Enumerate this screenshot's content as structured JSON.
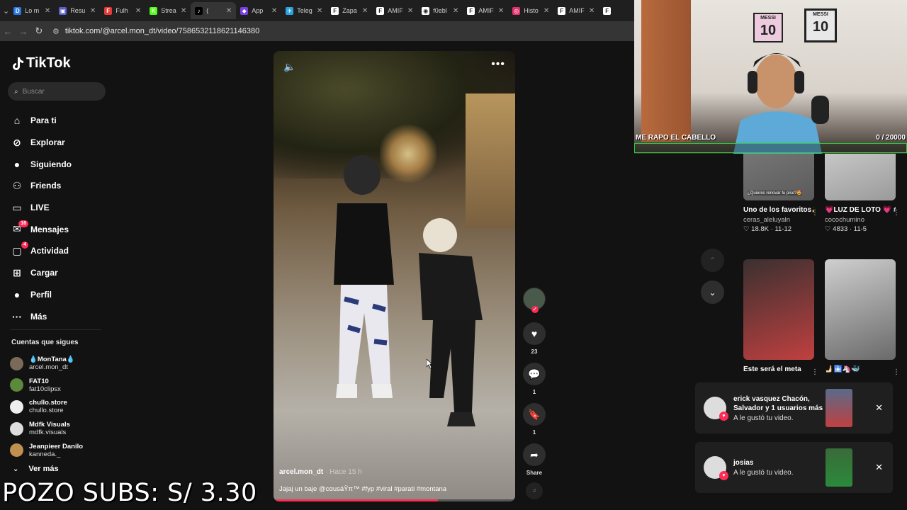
{
  "browser": {
    "tabs": [
      {
        "label": "Lo m",
        "color": "#2b78e4",
        "glyph": "D"
      },
      {
        "label": "Resu",
        "color": "#5b5fc7",
        "glyph": "▣"
      },
      {
        "label": "Fulh",
        "color": "#e53935",
        "glyph": "F"
      },
      {
        "label": "Strea",
        "color": "#53fc18",
        "glyph": "K"
      },
      {
        "label": "(",
        "color": "#000000",
        "glyph": "♪",
        "active": true
      },
      {
        "label": "App",
        "color": "#7b3fe4",
        "glyph": "◆"
      },
      {
        "label": "Teleg",
        "color": "#2aa3e0",
        "glyph": "✈"
      },
      {
        "label": "Zapa",
        "color": "#ffffff",
        "glyph": "F"
      },
      {
        "label": "AMIF",
        "color": "#ffffff",
        "glyph": "F"
      },
      {
        "label": "f0ebl",
        "color": "#ffffff",
        "glyph": "◉"
      },
      {
        "label": "AMIF",
        "color": "#ffffff",
        "glyph": "F"
      },
      {
        "label": "Histo",
        "color": "#e1306c",
        "glyph": "◎"
      },
      {
        "label": "AMIF",
        "color": "#ffffff",
        "glyph": "F"
      },
      {
        "label": "",
        "color": "#ffffff",
        "glyph": "F"
      }
    ],
    "url": "tiktok.com/@arcel.mon_dt/video/7586532118621146380"
  },
  "sidebar": {
    "logo": "TikTok",
    "search_placeholder": "Buscar",
    "menu": [
      {
        "label": "Para ti",
        "icon": "home-icon"
      },
      {
        "label": "Explorar",
        "icon": "compass-icon"
      },
      {
        "label": "Siguiendo",
        "icon": "following-icon"
      },
      {
        "label": "Friends",
        "icon": "friends-icon"
      },
      {
        "label": "LIVE",
        "icon": "live-icon"
      },
      {
        "label": "Mensajes",
        "icon": "messages-icon",
        "badge": "16"
      },
      {
        "label": "Actividad",
        "icon": "activity-icon",
        "badge": "4"
      },
      {
        "label": "Cargar",
        "icon": "upload-icon"
      },
      {
        "label": "Perfil",
        "icon": "profile-icon"
      },
      {
        "label": "Más",
        "icon": "more-icon"
      }
    ],
    "following_title": "Cuentas que sigues",
    "following": [
      {
        "name": "💧MonTana💧",
        "handle": "arcel.mon_dt",
        "color": "#7a6a5a"
      },
      {
        "name": "FAT10",
        "handle": "fat10clipsx",
        "color": "#5a8a3a"
      },
      {
        "name": "chullo.store",
        "handle": "chullo.store",
        "color": "#eeeeee"
      },
      {
        "name": "Mdfk Visuals",
        "handle": "mdfk.visuals",
        "color": "#dddddd"
      },
      {
        "name": "Jeanpieer Danilo",
        "handle": "kanneda._",
        "color": "#c09050"
      }
    ],
    "see_more": "Ver más"
  },
  "video": {
    "author": "arcel.mon_dt",
    "time": "· Hace 15 h",
    "caption": "Jajaj un baje @cαuѕáŸπ™ #fyp #viral #parati #montana",
    "progress": 0.68
  },
  "actions": {
    "likes": "23",
    "comments": "1",
    "saves": "1",
    "share": "Share"
  },
  "grid": [
    {
      "title": "Uno de los favoritos✨🫶🏻...",
      "user": "ceras_aleluyaln",
      "likes": "18.8K",
      "date": "11-12",
      "thumb_text": "¿Quieres renovar tu piso?🤩",
      "c1": "#8a8a8a",
      "c2": "#5a5a5a"
    },
    {
      "title": "💗LUZ DE LOTO 💗 #cocochumin...",
      "user": "cocochumino",
      "likes": "4833",
      "date": "11-5",
      "thumb_text": "",
      "c1": "#e8e8e8",
      "c2": "#9a9a9a"
    },
    {
      "title": "Este será el meta",
      "user": "",
      "likes": "",
      "date": "",
      "thumb_text": "",
      "c1": "#3a3030",
      "c2": "#c04040"
    },
    {
      "title": "🫸🏻🛅🦄🐳",
      "user": "",
      "likes": "",
      "date": "",
      "thumb_text": "",
      "c1": "#cfcfcf",
      "c2": "#6a6a6a"
    }
  ],
  "overlay": {
    "goal_label": "ME RAPO EL CABELLO",
    "goal_count": "0 / 20000",
    "frame1_top": "MESSI",
    "frame1_num": "10",
    "frame2_top": "MESSI",
    "frame2_num": "10",
    "pozo": "POZO SUBS: S/ 3.30"
  },
  "notifications": [
    {
      "names": "erick vasquez Chacón, Salvador y 1 usuarios más",
      "message": "A le gustó tu video."
    },
    {
      "names": "josias",
      "message": "A le gustó tu video."
    }
  ]
}
